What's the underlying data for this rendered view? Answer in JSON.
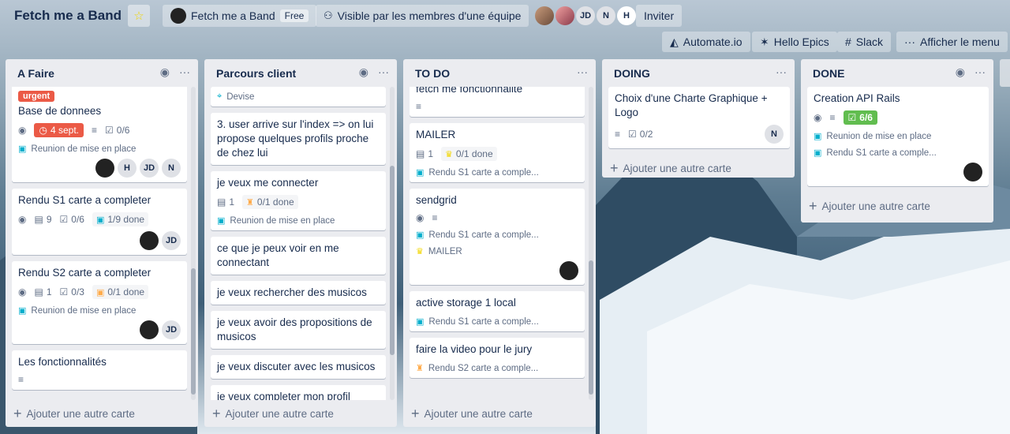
{
  "header": {
    "board_name": "Fetch me a Band",
    "workspace_label": "Fetch me a Band",
    "workspace_plan": "Free",
    "visibility_label": "Visible par les membres d'une équipe",
    "member_initials": [
      "JD",
      "N",
      "H"
    ],
    "invite_label": "Inviter"
  },
  "powerups": {
    "automate": "Automate.io",
    "epics": "Hello Epics",
    "slack": "Slack",
    "menu": "Afficher le menu"
  },
  "add_card_label": "Ajouter une autre carte",
  "lists": [
    {
      "title": "A Faire",
      "cards": [
        {
          "label": "urgent",
          "title": "Base de donnees",
          "due": "4 sept.",
          "checklist": "0/6",
          "sub": "Reunion de mise en place",
          "members": [
            "JD",
            "N",
            "H"
          ]
        },
        {
          "title": "Rendu S1 carte a completer",
          "attachments": "9",
          "checklist": "0/6",
          "done": "1/9 done",
          "members": [
            "JD"
          ]
        },
        {
          "title": "Rendu S2 carte a completer",
          "attachments": "1",
          "checklist": "0/3",
          "done": "0/1 done",
          "sub": "Reunion de mise en place",
          "members": [
            "JD"
          ]
        },
        {
          "title": "Les fonctionnalités"
        }
      ]
    },
    {
      "title": "Parcours client",
      "cards": [
        {
          "sub": "Devise"
        },
        {
          "title": "3. user arrive sur l'index => on lui propose quelques profils proche de chez lui"
        },
        {
          "title": "je veux me connecter",
          "attachments": "1",
          "done": "0/1 done",
          "sub": "Reunion de mise en place"
        },
        {
          "title": "ce que je peux voir en me connectant"
        },
        {
          "title": "je veux rechercher des musicos"
        },
        {
          "title": "je veux avoir des propositions de musicos"
        },
        {
          "title": "je veux discuter avec les musicos"
        },
        {
          "title": "je veux completer mon profil"
        }
      ]
    },
    {
      "title": "TO DO",
      "cards": [
        {
          "title": "fetch me fonctionnalite"
        },
        {
          "title": "MAILER",
          "attachments": "1",
          "done": "0/1 done",
          "sub": "Rendu S1 carte a comple..."
        },
        {
          "title": "sendgrid",
          "sub": "Rendu S1 carte a comple...",
          "sub2": "MAILER"
        },
        {
          "title": "active storage 1 local",
          "sub": "Rendu S1 carte a comple..."
        },
        {
          "title": "faire la video pour le jury",
          "sub": "Rendu S2 carte a comple..."
        }
      ]
    },
    {
      "title": "DOING",
      "cards": [
        {
          "title": "Choix d'une Charte Graphique + Logo",
          "checklist": "0/2",
          "members": [
            "N"
          ]
        }
      ]
    },
    {
      "title": "DONE",
      "cards": [
        {
          "title": "Creation API Rails",
          "checklist": "6/6",
          "sub": "Reunion de mise en place",
          "sub2": "Rendu S1 carte a comple..."
        }
      ]
    }
  ]
}
